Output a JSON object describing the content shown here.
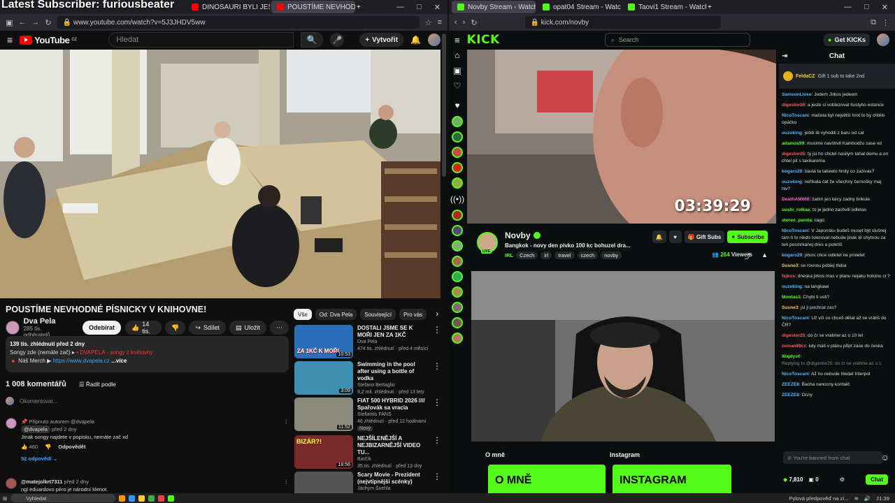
{
  "overlay_text": "Latest Subscriber: furiousbeater",
  "left_window": {
    "tabs": [
      {
        "label": "DINOSAURI BYLI JEŠTĚ HORŠÍ ...",
        "color": "#ff0000"
      },
      {
        "label": "POUSTÍME NEVHODNÉ PÍ...",
        "color": "#ff0000"
      }
    ],
    "new_tab": "+",
    "window_controls": [
      "—",
      "□",
      "✕"
    ],
    "url": "www.youtube.com/watch?v=5J3JHDV5ww"
  },
  "youtube": {
    "logo": "YouTube",
    "logo_region": "CZ",
    "search_placeholder": "Hledat",
    "create_label": "Vytvořit",
    "video_title": "POUSTÍME NEVHODNÉ PÍSNICKY V KNIHOVNE!",
    "channel_name": "Dva Pela",
    "channel_subs": "285 tis. odběratelů",
    "subscribe_label": "Odebírat",
    "likes": "14 tis.",
    "share_label": "Sdílet",
    "save_label": "Uložit",
    "description": {
      "stats": "139 tis. zhlédnutí  před 2 dny",
      "line2_prefix": "Songy zde (nemáte zač) ▸",
      "line2_link": "• DVAPELA · songy z knihovny",
      "line3_prefix": "🔺 Náš Merch ▶",
      "line3_link": "https://www.dvapela.cz",
      "more": "...více"
    },
    "comments_count": "1 008 komentářů",
    "sort_label": "Řadit podle",
    "add_comment": "Okomentovat...",
    "comments": [
      {
        "pinned": "Připnuto autorem @dvapela",
        "author": "@dvapela",
        "time": "před 2 dny",
        "text": "Jinak songy najdete v popisku, nemáte zač xd",
        "likes": "460",
        "reply": "Odpovědět",
        "replies": "52 odpovědí"
      },
      {
        "author": "@matejolkrt7311",
        "time": "před 2 dny",
        "text": "ngl eduardovo péro je národní klenot."
      }
    ],
    "filters": [
      "Vše",
      "Od: Dva Pela",
      "Související",
      "Pro vás"
    ],
    "recommendations": [
      {
        "title": "DOSTALI JSME SE K MOŘI JEN ZA 1KČ",
        "channel": "Dva Pela",
        "meta": "474 tis. zhlédnutí · před 4 měsíci",
        "duration": "10:53",
        "thumb_text": "ZA 1KČ K MOŘI",
        "color": "#2b6fb8"
      },
      {
        "title": "Swimming in the pool after using a bottle of vodka",
        "channel": "Stefano Bertaglio",
        "meta": "9,2 mil. zhlédnutí · před 13 lety",
        "duration": "3:09",
        "color": "#3d8fb0"
      },
      {
        "title": "FIAT 500 HYBRID 2026 //// Spařovák sa vracia",
        "channel": "Stellantis FANS",
        "meta": "46 zhlédnutí · před 12 hodinami",
        "badge": "Nový",
        "duration": "11:52",
        "color": "#8a8a7a"
      },
      {
        "title": "NEJŠÍLENĚJŠÍ A NEJBIZARNĚJŠÍ VIDEO TU...",
        "channel": "Barčík",
        "meta": "35 tis. zhlédnutí · před 13 dny",
        "duration": "18:56",
        "thumb_text": "BIZÁR?!",
        "color": "#7a2a2a"
      },
      {
        "title": "Scary Movie - Prezident (nejvtipnější scénky)",
        "channel": "Jáchym Švehla",
        "meta": "",
        "duration": "",
        "color": "#555"
      }
    ]
  },
  "right_window": {
    "tabs": [
      {
        "label": "Novby Stream - Watch Live on K",
        "color": "#53fc18"
      },
      {
        "label": "opat04 Stream - Watch Live on Kick",
        "color": "#53fc18"
      },
      {
        "label": "Taovi1 Stream - Watch Live on Kick",
        "color": "#53fc18"
      }
    ],
    "url": "kick.com/novby"
  },
  "kick": {
    "logo": "KICK",
    "search_placeholder": "Search",
    "get_kicks": "Get KICKs",
    "timer": "03:39:29",
    "streamer": "Novby",
    "stream_title": "Bangkok - novy den pivko 100 kc bohuzel dra...",
    "category": "IRL",
    "tags": [
      "Czech",
      "irl",
      "travel",
      "czech",
      "novby"
    ],
    "live_badge": "LIVE",
    "gift_subs": "Gift Subs",
    "subscribe": "Subscribe",
    "viewers": "264",
    "viewers_label": "Viewers",
    "about_label": "O mně",
    "instagram_label": "Instagram",
    "panel_about": "O MNĚ",
    "panel_insta": "INSTAGRAM",
    "chat": {
      "title": "Chat",
      "pinned_user": "FeldaCZ",
      "pinned_text": "Gift 1 sub to take 2nd",
      "messages": [
        {
          "user": "SamsonLivee",
          "text": "Jedem Jirkos jedeem",
          "color": "#5ab4ff"
        },
        {
          "user": "digestor25",
          "text": "a jeste si vobtezoval tlustyho estonce",
          "color": "#ff5a5a"
        },
        {
          "user": "NicoToscani",
          "text": "mačeta byl největší hrot to by chtělo opáčko",
          "color": "#5ab4ff"
        },
        {
          "user": "ouzoking",
          "text": "ještě tě vyhodili z baru od cat",
          "color": "#5ab4ff"
        },
        {
          "user": "adamos99",
          "text": "musime navštívit Kambodžu zase xd",
          "color": "#53fc18"
        },
        {
          "user": "digestor25",
          "text": "ty jsi ho chctel nasilym tahat domu a on chtel pit s taxikarema",
          "color": "#ff5a5a"
        },
        {
          "user": "kogaro29",
          "text": "bavia ta takeeto hroty co zazivas?",
          "color": "#5ab4ff"
        },
        {
          "user": "ouzoking",
          "text": "neříkala cat že všechny černošky maj hiv?",
          "color": "#5ab4ff"
        },
        {
          "user": "DeathAM666",
          "text": "zatím jen kecy zadny brikule",
          "color": "#ff5acd"
        },
        {
          "user": "sushi_rolkaa",
          "text": "to je jedno zachvili odletas",
          "color": "#53fc18"
        },
        {
          "user": "stereo_panda",
          "text": "cago",
          "color": "#53fc18"
        },
        {
          "user": "NicoToscani",
          "text": "V Japonsku budeš muset být slušnej tam ti to nikdo tolerovat nebude jinak tě chytnou za ten posmrkanej dres a poletíš",
          "color": "#5ab4ff"
        },
        {
          "user": "kogaro29",
          "text": "jirkos chce odletet ne proletet",
          "color": "#5ab4ff"
        },
        {
          "user": "Susne3",
          "text": "se rovnou pobiej třeba",
          "color": "#f4d03f"
        },
        {
          "user": "fejkos",
          "text": "dneska jirkos mas v planu nejaku holcinu ci ?",
          "color": "#ff5a5a"
        },
        {
          "user": "ouzoking",
          "text": "na langkawi",
          "color": "#5ab4ff"
        },
        {
          "user": "Montas1",
          "text": "Chybi ti usti?",
          "color": "#53fc18"
        },
        {
          "user": "Susne3",
          "text": "jsi ji pochcal zas?",
          "color": "#f4d03f"
        },
        {
          "user": "NicoToscani",
          "text": "Už víš co chceš dělat až se vrátíš do ČR?",
          "color": "#5ab4ff"
        },
        {
          "user": "digestor25",
          "text": "do čr se vratime az o 10 let",
          "color": "#ff5a5a"
        },
        {
          "user": "zeman99cz",
          "text": "kdy máš v plánu připt zase do česka",
          "color": "#ff5a5a"
        },
        {
          "user": "Wajdys0",
          "text": "",
          "color": "#53fc18"
        },
        {
          "user": "NicoToscani",
          "text": "Až ho nebude hledat Interpol",
          "color": "#5ab4ff"
        },
        {
          "user": "ZEEZE8",
          "text": "Bacha nanocny kontakt",
          "color": "#5ab4ff"
        },
        {
          "user": "ZEEZE8",
          "text": "Ocny",
          "color": "#5ab4ff"
        }
      ],
      "replying_to": "Replying to @digestor25: do čr se vratime az o 1",
      "input_placeholder": "You're banned from chat",
      "points": "7,810",
      "zero": "0",
      "chat_button": "Chat"
    }
  },
  "taskbar": {
    "search_placeholder": "Vyhledat",
    "weather": "Pylová předpověď na zí...",
    "time": "21:39"
  }
}
